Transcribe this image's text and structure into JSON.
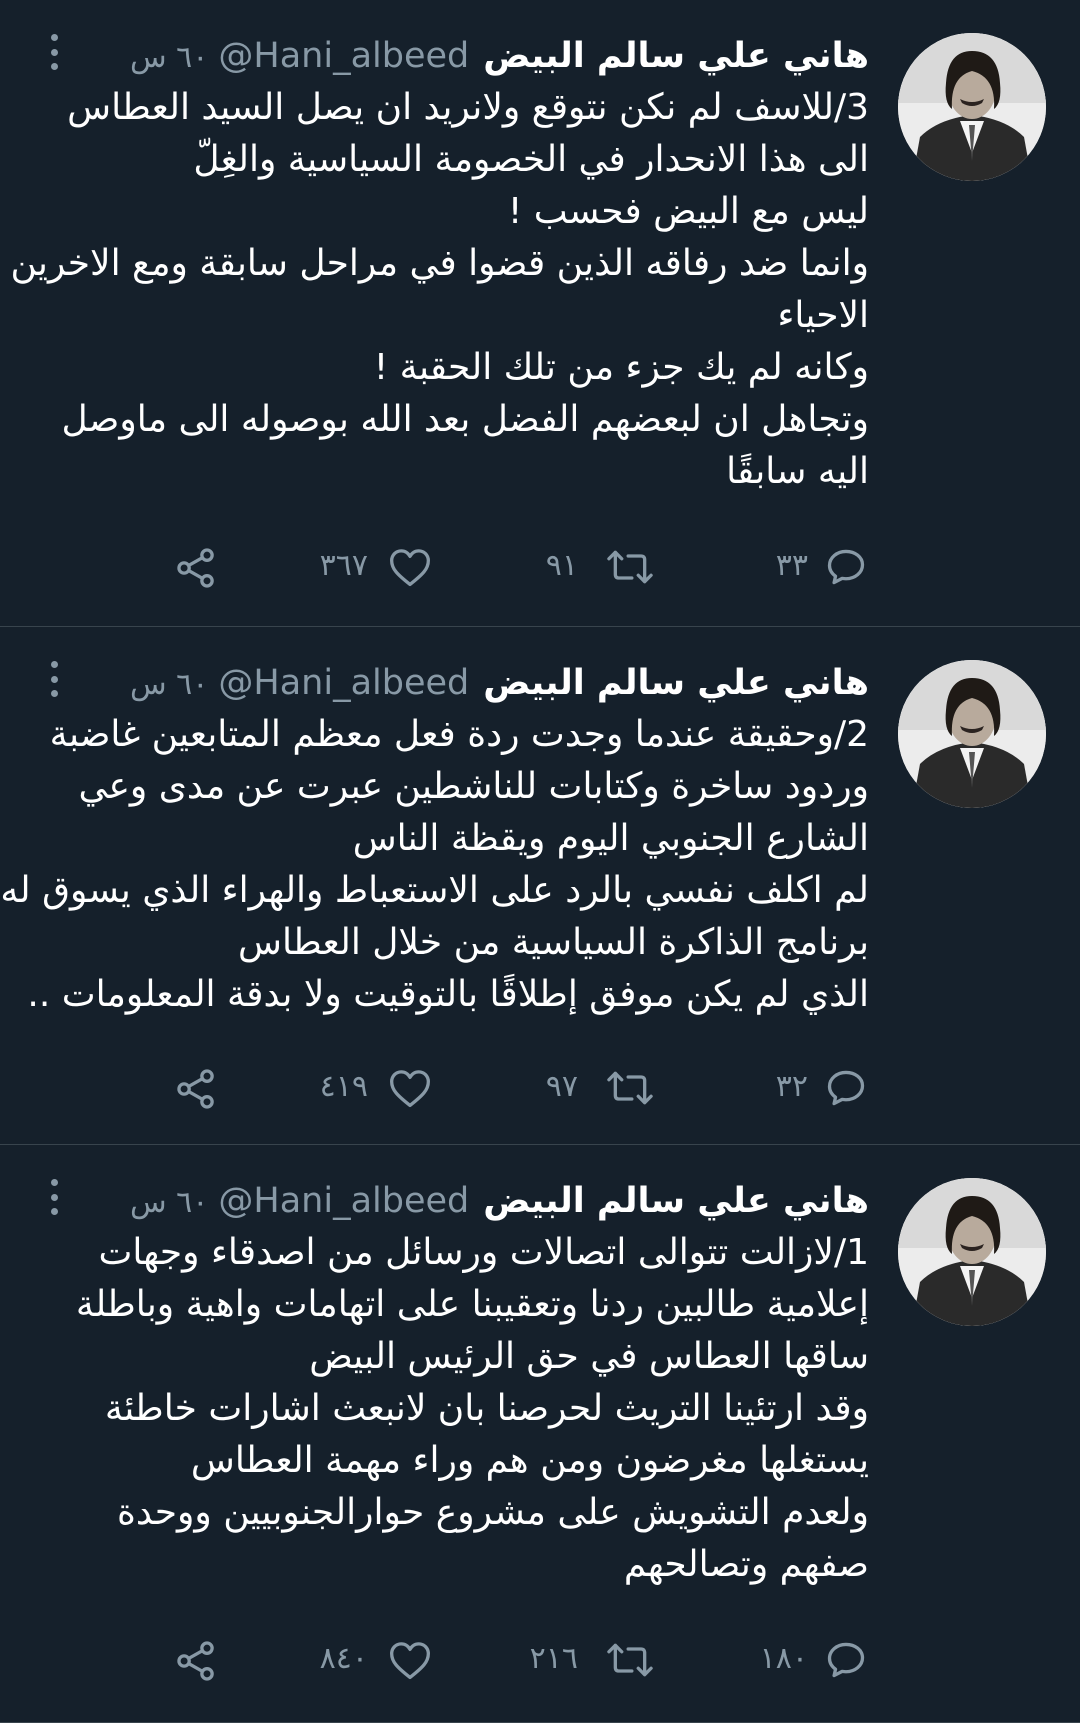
{
  "colors": {
    "background": "#15202b",
    "text": "#ffffff",
    "muted": "#8899a6",
    "divider": "#38444d"
  },
  "tweets": [
    {
      "display_name": "هاني علي سالم البيض",
      "handle": "@Hani_albeed",
      "timestamp": "٦٠ س",
      "text_lines": [
        "3/للاسف لم نكن نتوقع ولانريد ان يصل السيد العطاس",
        "الى هذا الانحدار في الخصومة السياسية والغِلّ",
        "ليس مع البيض فحسب !",
        "وانما ضد رفاقه الذين قضوا في مراحل سابقة ومع الاخرين",
        "الاحياء",
        "وكانه لم يك جزء من تلك الحقبة !",
        "وتجاهل ان لبعضهم الفضل بعد الله بوصوله الى ماوصل",
        "اليه سابقًا"
      ],
      "replies": "٣٣",
      "retweets": "٩١",
      "likes": "٣٦٧",
      "icons": [
        "more-icon",
        "reply-icon",
        "retweet-icon",
        "like-icon",
        "share-icon"
      ]
    },
    {
      "display_name": "هاني علي سالم البيض",
      "handle": "@Hani_albeed",
      "timestamp": "٦٠ س",
      "text_lines": [
        "2/وحقيقة عندما وجدت ردة فعل معظم المتابعين غاضبة",
        "وردود ساخرة وكتابات للناشطين عبرت عن مدى وعي",
        "الشارع الجنوبي اليوم ويقظة الناس",
        "لم اكلف نفسي بالرد على الاستعباط والهراء الذي يسوق له",
        "برنامج الذاكرة السياسية من خلال العطاس",
        "الذي لم يكن موفق إطلاقًا بالتوقيت ولا بدقة المعلومات .."
      ],
      "replies": "٣٢",
      "retweets": "٩٧",
      "likes": "٤١٩",
      "icons": [
        "more-icon",
        "reply-icon",
        "retweet-icon",
        "like-icon",
        "share-icon"
      ]
    },
    {
      "display_name": "هاني علي سالم البيض",
      "handle": "@Hani_albeed",
      "timestamp": "٦٠ س",
      "text_lines": [
        "1/لازالت تتوالى اتصالات ورسائل من اصدقاء وجهات",
        "إعلامية طالبين ردنا وتعقيبنا على اتهامات واهية وباطلة",
        "ساقها العطاس في حق الرئيس البيض",
        "وقد ارتئينا التريث لحرصنا بان لانبعث اشارات خاطئة",
        "يستغلها مغرضون ومن هم وراء مهمة العطاس",
        "ولعدم التشويش على مشروع حوارالجنوبيين ووحدة",
        "صفهم وتصالحهم"
      ],
      "replies": "١٨٠",
      "retweets": "٢١٦",
      "likes": "٨٤٠",
      "icons": [
        "more-icon",
        "reply-icon",
        "retweet-icon",
        "like-icon",
        "share-icon"
      ]
    }
  ]
}
